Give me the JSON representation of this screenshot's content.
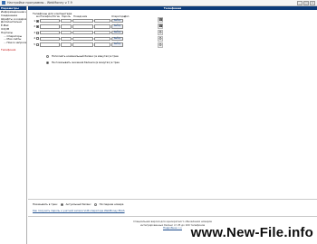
{
  "window": {
    "title": "Настройки программы - WebMoney v.7.9",
    "minimize": "_",
    "maximize": "□",
    "close": "x"
  },
  "left_panel": {
    "header": "Параметры",
    "items": [
      {
        "label": "Информационная копия"
      },
      {
        "label": "Соединение"
      },
      {
        "label": "Шрифты и кодировка"
      },
      {
        "label": "Дополнительно"
      },
      {
        "label": "E-Mail"
      },
      {
        "label": "ICQ/IM"
      },
      {
        "label": "Порталы"
      },
      {
        "label": "... Операторы",
        "sub": true
      },
      {
        "label": "... Мои сайты",
        "sub": true
      },
      {
        "label": "... Поиск запроса",
        "sub": true
      },
      {
        "label": ""
      },
      {
        "label": "Телефония",
        "active": true
      }
    ]
  },
  "main": {
    "header": "Телефония",
    "section_title": "Телефоны для компьютера",
    "columns": [
      "вкл",
      "Телефон/Логин",
      "Пароль",
      "Псевдоним",
      "Операторы",
      "Доп."
    ],
    "rows": [
      {
        "num": "1",
        "checked": true,
        "button": "Выбор"
      },
      {
        "num": "2",
        "checked": true,
        "button": "Выбор"
      },
      {
        "num": "3",
        "checked": false,
        "button": "Выбор"
      },
      {
        "num": "4",
        "checked": false,
        "button": "Выбор"
      },
      {
        "num": "5",
        "checked": false,
        "button": "Выбор"
      }
    ],
    "side_icons": [
      "phone-icon",
      "phone-icon",
      "gear-icon",
      "gear-icon",
      "gear-icon"
    ],
    "options": [
      {
        "label": "Пополнять номинальный баланс (в минутах) в трее",
        "selected": false
      },
      {
        "label": "Не показывать значения баланса (в минутах) в трее",
        "selected": true
      }
    ]
  },
  "footer": {
    "show_label": "Показывать в трее:",
    "radios": [
      {
        "label": "Актуальный баланс",
        "selected": true
      },
      {
        "label": "Последние номера",
        "selected": false
      }
    ],
    "link": "Как получить пароль к учетной записи VoIP-оператора WebMoney EKAS",
    "notice_line1": "Специальная версия для однократного обновления номеров",
    "notice_line2": "интегрированных баланс от 25 до 100 телефонов",
    "notice_more": "Подробнее >>"
  },
  "watermark": "www.New-File.info"
}
